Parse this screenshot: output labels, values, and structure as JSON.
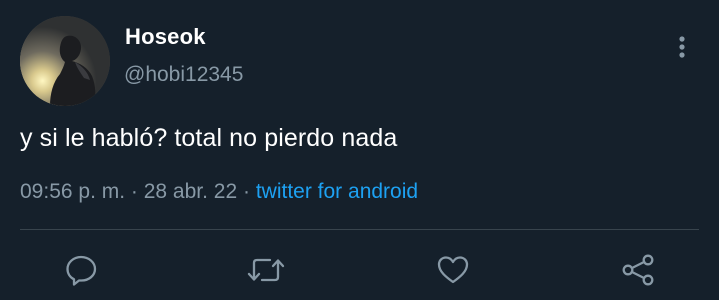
{
  "tweet": {
    "display_name": "Hoseok",
    "handle": "@hobi12345",
    "text": "y si le habló? total no pierdo nada",
    "time": "09:56 p. m.",
    "separator": " · ",
    "date": "28 abr. 22",
    "source": "twitter for android"
  },
  "icons": {
    "more": "more-vertical-icon",
    "reply": "reply-icon",
    "retweet": "retweet-icon",
    "like": "heart-icon",
    "share": "share-icon"
  },
  "colors": {
    "background": "#15202b",
    "secondary_text": "#8899a6",
    "accent": "#1da1f2",
    "divider": "#38444d"
  }
}
